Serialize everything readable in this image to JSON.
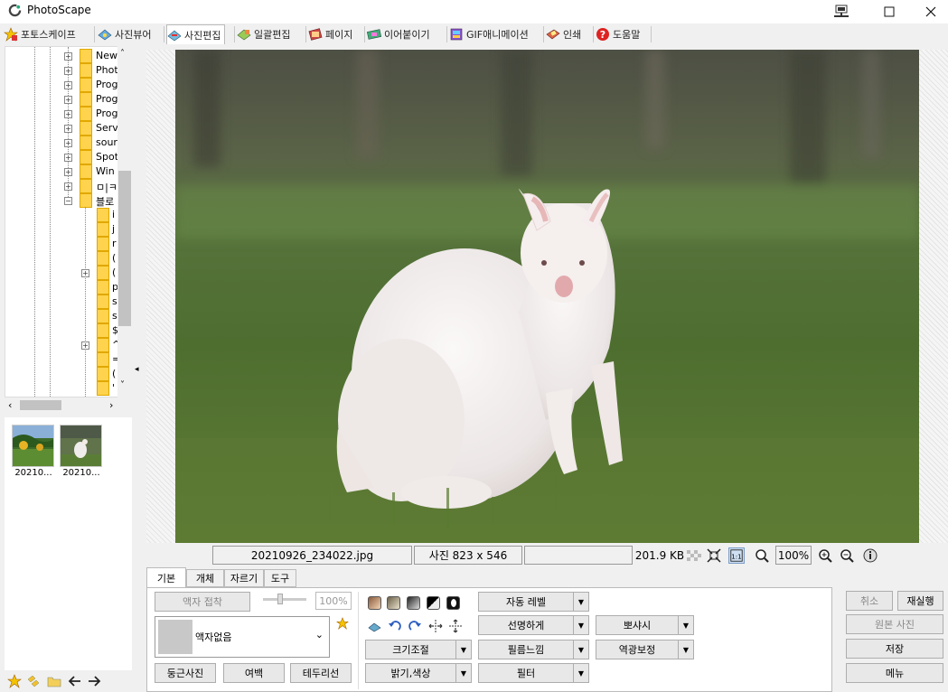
{
  "app": {
    "title": "PhotoScape"
  },
  "tabs": [
    {
      "label": "포토스케이프",
      "icon": "star-icon"
    },
    {
      "label": "사진뷰어",
      "icon": "viewer-icon"
    },
    {
      "label": "사진편집",
      "icon": "editor-icon"
    },
    {
      "label": "일괄편집",
      "icon": "batch-icon"
    },
    {
      "label": "페이지",
      "icon": "page-icon"
    },
    {
      "label": "이어붙이기",
      "icon": "combine-icon"
    },
    {
      "label": "GIF애니메이션",
      "icon": "gif-icon"
    },
    {
      "label": "인쇄",
      "icon": "print-icon"
    },
    {
      "label": "도움말",
      "icon": "help-icon"
    }
  ],
  "tree": {
    "nodes": [
      "New",
      "Phot",
      "Prog",
      "Prog",
      "Prog",
      "Serv",
      "sour",
      "Spot",
      "Win",
      "ㅁ|ㅋ",
      "블로"
    ],
    "subnodes": [
      "i",
      "j",
      "r",
      "(",
      "(",
      "p",
      "s",
      "s",
      "$",
      "^",
      "=",
      "(",
      "'"
    ]
  },
  "thumbnails": [
    {
      "label": "20210..."
    },
    {
      "label": "20210..."
    }
  ],
  "status": {
    "filename": "20210926_234022.jpg",
    "dimensions": "사진 823 x 546",
    "filesize": "201.9 KB",
    "zoom": "100%"
  },
  "edit_tabs": [
    "기본",
    "개체",
    "자르기",
    "도구"
  ],
  "panel": {
    "frame_btn": "액자 접착",
    "slider_value": "100%",
    "frame_select": "액자없음",
    "round_btn": "둥근사진",
    "margin_btn": "여백",
    "border_btn": "테두리선",
    "resize": "크기조절",
    "brightness": "밝기,색상",
    "auto_level": "자동 레벨",
    "sharpen": "선명하게",
    "film": "필름느낌",
    "filter": "필터",
    "bloom": "뽀샤시",
    "backlight": "역광보정"
  },
  "right": {
    "undo": "취소",
    "redo": "재실행",
    "original": "원본 사진",
    "save": "저장",
    "menu": "메뉴"
  }
}
